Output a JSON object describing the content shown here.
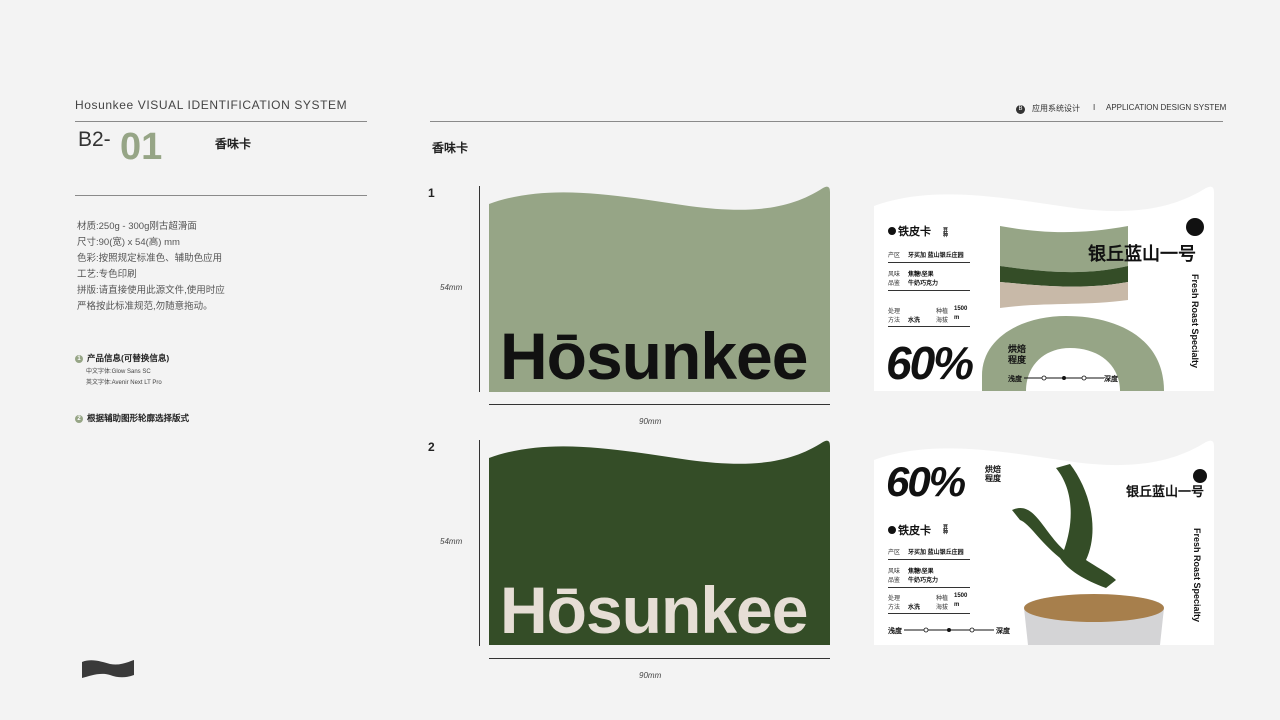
{
  "header": {
    "title": "Hosunkee VISUAL IDENTIFICATION SYSTEM",
    "right_icon_letter": "B",
    "right_cn": "应用系统设计",
    "right_sep": "I",
    "right_en": "APPLICATION DESIGN SYSTEM"
  },
  "page": {
    "code_prefix": "B2-",
    "code_num": "01",
    "name": "香味卡",
    "section_title": "香味卡"
  },
  "specs": [
    "材质:250g - 300g刚古超滑面",
    "尺寸:90(宽) x 54(高) mm",
    "色彩:按照规定标准色、辅助色应用",
    "工艺:专色印刷",
    "拼版:请直接使用此源文件,使用时应",
    "严格按此标准规范,勿随意拖动。"
  ],
  "notes": {
    "n1": "1",
    "n1_text": "产品信息(可替换信息)",
    "font_cn": "中文字体:Glow Sans SC",
    "font_en": "英文字体:Avenir Next LT Pro",
    "n2": "2",
    "n2_text": "根据辅助图形轮廓选择版式"
  },
  "cards": [
    {
      "index": "1",
      "height_label": "54mm",
      "width_label": "90mm",
      "brand": "Hōsunkee",
      "bg_color": "#96a586",
      "text_color": "#111111"
    },
    {
      "index": "2",
      "height_label": "54mm",
      "width_label": "90mm",
      "brand": "Hōsunkee",
      "bg_color": "#344d27",
      "text_color": "#e6ded5"
    }
  ],
  "label": {
    "product_type": "铁皮卡",
    "type_small": "豆种",
    "origin_key": "产区",
    "origin_val": "牙买加 蓝山银丘庄园",
    "flavor_key1": "风味",
    "flavor_key2": "品鉴",
    "flavor_val1": "焦糖\\坚果",
    "flavor_val2": "牛奶巧克力",
    "process_key1": "处理",
    "process_key2": "方法",
    "process_val": "水洗",
    "altitude_key1": "种植",
    "altitude_key2": "海拔",
    "altitude_val1": "1500",
    "altitude_val2": "m",
    "name": "银丘蓝山一号",
    "vertical_text": "Fresh Roast Specialty",
    "percent": "60%",
    "roast_label1": "烘焙",
    "roast_label2": "程度",
    "light": "浅度",
    "dark": "深度"
  },
  "colors": {
    "sage": "#96a586",
    "forest": "#344d27",
    "beige": "#c8b9a8",
    "coffee": "#a77f4c",
    "accent_number": "#96a586"
  }
}
